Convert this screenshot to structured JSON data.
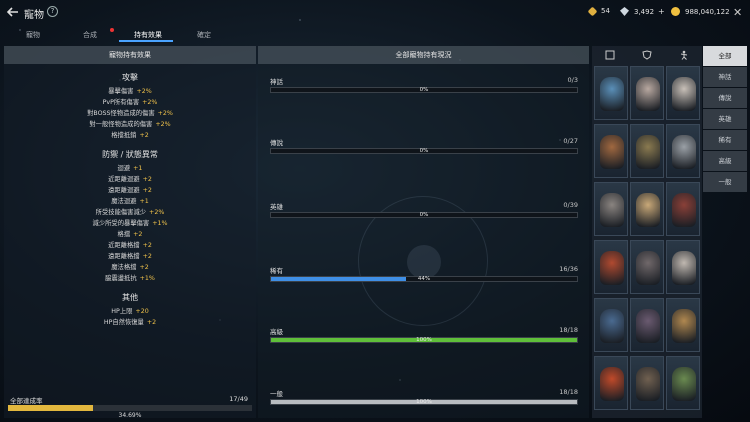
{
  "header": {
    "title": "寵物",
    "help": "?",
    "resources": [
      {
        "icon": "gem-icon",
        "value": "54",
        "color": "#e0b040"
      },
      {
        "icon": "diamond-icon",
        "value": "3,492",
        "color": "#cfd8e0"
      },
      {
        "icon": "gold-coin-icon",
        "value": "988,040,122",
        "color": "#f0c040"
      }
    ]
  },
  "tabs": [
    {
      "label": "寵物"
    },
    {
      "label": "合成"
    },
    {
      "label": "持有效果"
    },
    {
      "label": "確定"
    }
  ],
  "left_panel": {
    "title": "寵物持有效果",
    "sections": [
      {
        "heading": "攻擊",
        "lines": [
          {
            "label": "暴擊傷害",
            "value": "+2%"
          },
          {
            "label": "PvP所有傷害",
            "value": "+2%"
          },
          {
            "label": "對BOSS怪物造成的傷害",
            "value": "+2%"
          },
          {
            "label": "對一般怪物造成的傷害",
            "value": "+2%"
          },
          {
            "label": "格擋抵銷",
            "value": "+2"
          }
        ]
      },
      {
        "heading": "防禦 / 狀態異常",
        "lines": [
          {
            "label": "迴避",
            "value": "+1"
          },
          {
            "label": "近距離迴避",
            "value": "+2"
          },
          {
            "label": "遠距離迴避",
            "value": "+2"
          },
          {
            "label": "魔法迴避",
            "value": "+1"
          },
          {
            "label": "所受技能傷害減少",
            "value": "+2%"
          },
          {
            "label": "減少所受的暴擊傷害",
            "value": "+1%"
          },
          {
            "label": "格擋",
            "value": "+2"
          },
          {
            "label": "近距離格擋",
            "value": "+2"
          },
          {
            "label": "遠距離格擋",
            "value": "+2"
          },
          {
            "label": "魔法格擋",
            "value": "+2"
          },
          {
            "label": "脇震盪抵抗",
            "value": "+1%"
          }
        ]
      },
      {
        "heading": "其他",
        "lines": [
          {
            "label": "HP上限",
            "value": "+20"
          },
          {
            "label": "HP自然恢復量",
            "value": "+2"
          }
        ]
      }
    ],
    "total": {
      "label": "全部達成率",
      "count": "17/49",
      "percent_text": "34.69%",
      "percent": 34.69
    }
  },
  "center_panel": {
    "title": "全部寵物持有現況",
    "grades": [
      {
        "name": "神話",
        "count": "0/3",
        "percent_text": "0%",
        "percent": 0,
        "color": "#3a8de0"
      },
      {
        "name": "傳說",
        "count": "0/27",
        "percent_text": "0%",
        "percent": 0,
        "color": "#3a8de0"
      },
      {
        "name": "英雄",
        "count": "0/39",
        "percent_text": "0%",
        "percent": 0,
        "color": "#3a8de0"
      },
      {
        "name": "稀有",
        "count": "16/36",
        "percent_text": "44%",
        "percent": 44,
        "color": "#3f8fe6"
      },
      {
        "name": "高級",
        "count": "18/18",
        "percent_text": "100%",
        "percent": 100,
        "color": "#5fbf3a"
      },
      {
        "name": "一般",
        "count": "18/18",
        "percent_text": "100%",
        "percent": 100,
        "color": "#b8bcc0"
      }
    ]
  },
  "grid_header_icons": [
    "frame-icon",
    "shield-icon",
    "dancing-figure-icon"
  ],
  "pets": [
    {
      "icon": "blue-beast-pet-icon",
      "color": "#5a8fb8"
    },
    {
      "icon": "pale-ghoul-pet-icon",
      "color": "#b8a8a0"
    },
    {
      "icon": "skull-mask-pet-icon",
      "color": "#c8c0b8"
    },
    {
      "icon": "brown-dog-pet-icon",
      "color": "#a06840"
    },
    {
      "icon": "gold-armor-pet-icon",
      "color": "#8a7a50"
    },
    {
      "icon": "helmet-knight-pet-icon",
      "color": "#9aa0a6"
    },
    {
      "icon": "grey-cat-pet-icon",
      "color": "#8a8480"
    },
    {
      "icon": "elf-girl-pet-icon",
      "color": "#c8a878"
    },
    {
      "icon": "red-dwarf-pet-icon",
      "color": "#8a4038"
    },
    {
      "icon": "red-demon-pet-icon",
      "color": "#b04a30"
    },
    {
      "icon": "dark-elf-pet-icon",
      "color": "#70686a"
    },
    {
      "icon": "skeleton-pet-icon",
      "color": "#c0b8b0"
    },
    {
      "icon": "blue-troll-pet-icon",
      "color": "#4a6a90"
    },
    {
      "icon": "bat-creature-pet-icon",
      "color": "#6a5a70"
    },
    {
      "icon": "owl-pet-icon",
      "color": "#b08850"
    },
    {
      "icon": "fire-imp-pet-icon",
      "color": "#c04a2a"
    },
    {
      "icon": "bearded-warrior-pet-icon",
      "color": "#706050"
    },
    {
      "icon": "green-goblin-pet-icon",
      "color": "#6a8a50"
    }
  ],
  "filters": [
    {
      "label": "全部",
      "active": true
    },
    {
      "label": "神話"
    },
    {
      "label": "傳說"
    },
    {
      "label": "英雄"
    },
    {
      "label": "稀有"
    },
    {
      "label": "高級"
    },
    {
      "label": "一般"
    }
  ]
}
